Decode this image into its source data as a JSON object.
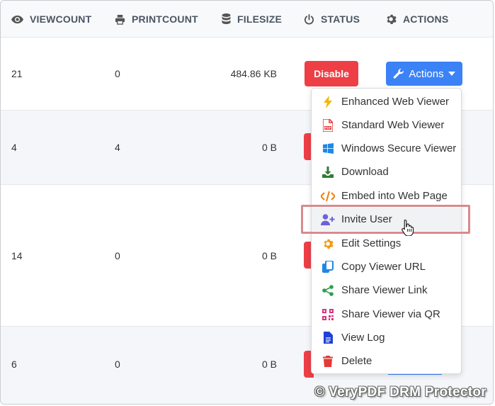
{
  "header": {
    "viewcount": "VIEWCOUNT",
    "printcount": "PRINTCOUNT",
    "filesize": "FILESIZE",
    "status": "STATUS",
    "actions": "ACTIONS"
  },
  "rows": [
    {
      "viewcount": "21",
      "printcount": "0",
      "filesize": "484.86 KB",
      "status_button": "Disable",
      "actions_button": "Actions"
    },
    {
      "viewcount": "4",
      "printcount": "4",
      "filesize": "0 B"
    },
    {
      "viewcount": "14",
      "printcount": "0",
      "filesize": "0 B"
    },
    {
      "viewcount": "6",
      "printcount": "0",
      "filesize": "0 B"
    }
  ],
  "menu": {
    "items": [
      {
        "label": "Enhanced Web Viewer",
        "icon": "bolt-icon",
        "color": "#f4b400"
      },
      {
        "label": "Standard Web Viewer",
        "icon": "pdf-file-icon",
        "color": "#e53935"
      },
      {
        "label": "Windows Secure Viewer",
        "icon": "windows-icon",
        "color": "#1e88e5"
      },
      {
        "label": "Download",
        "icon": "download-icon",
        "color": "#2e7d32"
      },
      {
        "label": "Embed into Web Page",
        "icon": "code-icon",
        "color": "#f57c00"
      },
      {
        "label": "Invite User",
        "icon": "user-plus-icon",
        "color": "#6c63d9"
      },
      {
        "label": "Edit Settings",
        "icon": "gear-icon",
        "color": "#f39c12"
      },
      {
        "label": "Copy Viewer URL",
        "icon": "copy-icon",
        "color": "#1e88e5"
      },
      {
        "label": "Share Viewer Link",
        "icon": "share-icon",
        "color": "#2e9e4f"
      },
      {
        "label": "Share Viewer via QR",
        "icon": "qrcode-icon",
        "color": "#d63384"
      },
      {
        "label": "View Log",
        "icon": "file-lines-icon",
        "color": "#1e40d8"
      },
      {
        "label": "Delete",
        "icon": "trash-icon",
        "color": "#e53935"
      }
    ]
  },
  "colors": {
    "disable": "#ee3f46",
    "actions": "#3b82f6",
    "highlight": "#d98a8f"
  },
  "watermark": "© VeryPDF DRM Protector"
}
